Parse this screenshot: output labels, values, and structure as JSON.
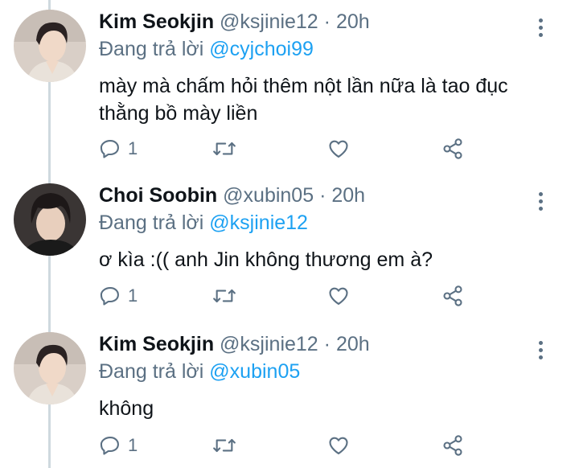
{
  "tweets": [
    {
      "display_name": "Kim Seokjin",
      "handle": "@ksjinie12",
      "separator": "·",
      "time": "20h",
      "replying_prefix": "Đang trả lời",
      "replying_to": "@cyjchoi99",
      "text": "mày mà chấm hỏi thêm nột lần nữa là tao đục thằng bồ mày liền",
      "reply_count": "1",
      "avatar_icon": "profile-photo-icon"
    },
    {
      "display_name": "Choi Soobin",
      "handle": "@xubin05",
      "separator": "·",
      "time": "20h",
      "replying_prefix": "Đang trả lời",
      "replying_to": "@ksjinie12",
      "text": "ơ kìa :(( anh Jin không thương em à?",
      "reply_count": "1",
      "avatar_icon": "profile-photo-icon"
    },
    {
      "display_name": "Kim Seokjin",
      "handle": "@ksjinie12",
      "separator": "·",
      "time": "20h",
      "replying_prefix": "Đang trả lời",
      "replying_to": "@xubin05",
      "text": "không",
      "reply_count": "1",
      "avatar_icon": "profile-photo-icon"
    }
  ],
  "icons": {
    "reply": "reply-icon",
    "retweet": "retweet-icon",
    "like": "heart-icon",
    "share": "share-icon",
    "more": "more-vertical-icon"
  },
  "colors": {
    "text": "#0f1419",
    "secondary": "#5b7083",
    "link": "#1da1f2",
    "thread_line": "#cfd9de"
  }
}
